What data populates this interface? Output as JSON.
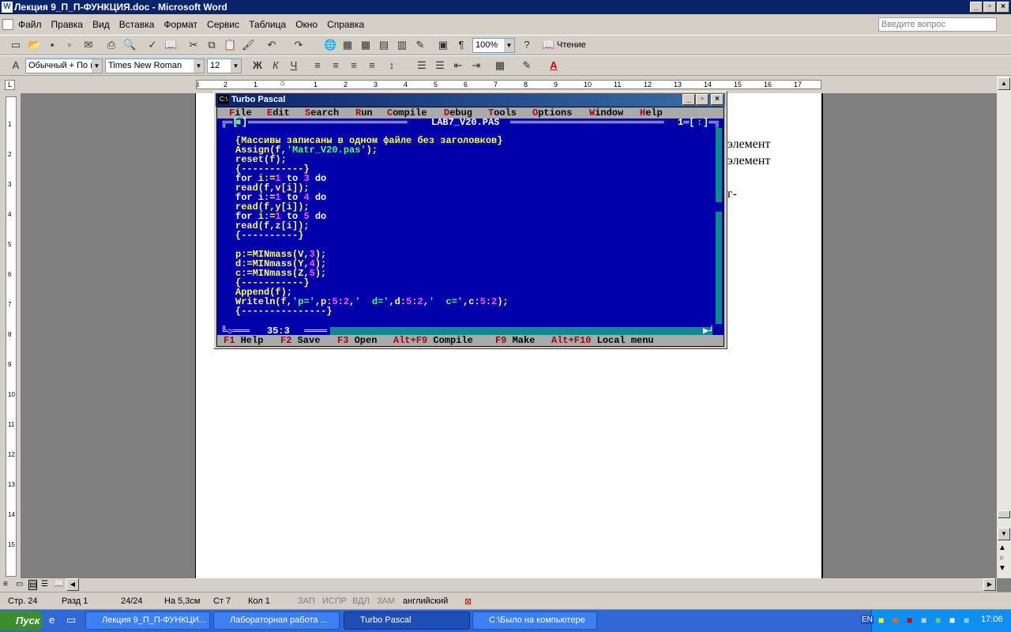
{
  "word": {
    "title": "Лекция 9_П_П-ФУНКЦИЯ.doc - Microsoft Word",
    "menu": [
      "Файл",
      "Правка",
      "Вид",
      "Вставка",
      "Формат",
      "Сервис",
      "Таблица",
      "Окно",
      "Справка"
    ],
    "ask_placeholder": "Введите вопрос",
    "zoom": "100%",
    "reading_label": "Чтение",
    "style": "Обычный + По ц",
    "font": "Times New Roman",
    "font_size": "12",
    "ruler_numbers": [
      "3",
      "2",
      "1",
      "1",
      "2",
      "3",
      "4",
      "5",
      "6",
      "7",
      "8",
      "9",
      "10",
      "11",
      "12",
      "13",
      "14",
      "15",
      "16",
      "17"
    ],
    "page_fragments": [
      "элемент",
      "элемент",
      "г-"
    ]
  },
  "status": {
    "page": "Стр. 24",
    "section": "Разд 1",
    "pages": "24/24",
    "at": "На 5,3см",
    "line": "Ст 7",
    "col": "Кол 1",
    "rec": "ЗАП",
    "trk": "ИСПР",
    "ext": "ВДЛ",
    "ovr": "ЗАМ",
    "lang": "английский"
  },
  "taskbar": {
    "start": "Пуск",
    "tasks": [
      "Лекция 9_П_П-ФУНКЦИ...",
      "Лабораторная работа ...",
      "Turbo Pascal",
      "C:\\Было на компьютере"
    ],
    "tray_lang": "EN",
    "clock": "17:06"
  },
  "tp": {
    "title": "Turbo Pascal",
    "menu": [
      "File",
      "Edit",
      "Search",
      "Run",
      "Compile",
      "Debug",
      "Tools",
      "Options",
      "Window",
      "Help"
    ],
    "filename": "LAB7_V20.PAS",
    "window_number": "1",
    "cursor_pos": "35:3",
    "code": [
      "{Массивы записаны в одном файле без заголовков}",
      "Assign(f,'Matr_V20.pas');",
      "reset(f);",
      "{-----------}",
      "for i:=1 to 3 do",
      "read(f,v[i]);",
      "for i:=1 to 4 do",
      "read(f,y[i]);",
      "for i:=1 to 5 do",
      "read(f,z[i]);",
      "{----------}",
      "",
      "p:=MINmass(V,3);",
      "d:=MINmass(Y,4);",
      "c:=MINmass(Z,5);",
      "{-----------}",
      "Append(f);",
      "Writeln(f,'p=',p:5:2,'  d=',d:5:2,'  c=',c:5:2);",
      "{---------------}"
    ],
    "hints": [
      {
        "key": "F1",
        "label": "Help"
      },
      {
        "key": "F2",
        "label": "Save"
      },
      {
        "key": "F3",
        "label": "Open"
      },
      {
        "key": "Alt+F9",
        "label": "Compile"
      },
      {
        "key": "F9",
        "label": "Make"
      },
      {
        "key": "Alt+F10",
        "label": "Local menu"
      }
    ]
  }
}
